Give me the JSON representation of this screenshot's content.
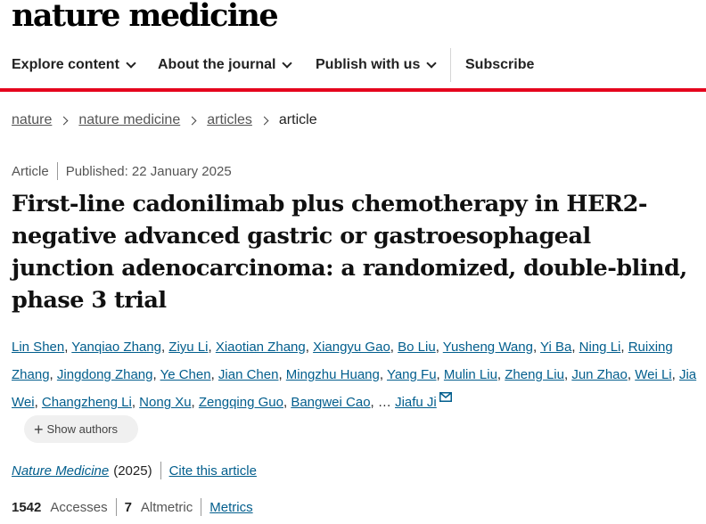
{
  "logo": "nature medicine",
  "nav": {
    "explore": "Explore content",
    "about": "About the journal",
    "publish": "Publish with us",
    "subscribe": "Subscribe"
  },
  "breadcrumb": [
    "nature",
    "nature medicine",
    "articles",
    "article"
  ],
  "article": {
    "type": "Article",
    "published": "Published: 22 January 2025",
    "title": "First-line cadonilimab plus chemotherapy in HER2-negative advanced gastric or gastroesophageal junction adenocarcinoma: a randomized, double-blind, phase 3 trial"
  },
  "authors": [
    "Lin Shen",
    "Yanqiao Zhang",
    "Ziyu Li",
    "Xiaotian Zhang",
    "Xiangyu Gao",
    "Bo Liu",
    "Yusheng Wang",
    "Yi Ba",
    "Ning Li",
    "Ruixing Zhang",
    "Jingdong Zhang",
    "Ye Chen",
    "Jian Chen",
    "Mingzhu Huang",
    "Yang Fu",
    "Mulin Liu",
    "Zheng Liu",
    "Jun Zhao",
    "Wei Li",
    "Jia Wei",
    "Changzheng Li",
    "Nong Xu",
    "Zengqing Guo",
    "Bangwei Cao",
    "Jiafu Ji"
  ],
  "authors_ellipsis": "…",
  "show_authors": "Show authors",
  "citation": {
    "journal": "Nature Medicine",
    "year": "(2025)",
    "cite": "Cite this article"
  },
  "metrics": {
    "accesses_count": "1542",
    "accesses_label": "Accesses",
    "altmetric_count": "7",
    "altmetric_label": "Altmetric",
    "metrics_link": "Metrics"
  },
  "colors": {
    "accent_red": "#e5041d",
    "link_blue": "#025e8d"
  }
}
